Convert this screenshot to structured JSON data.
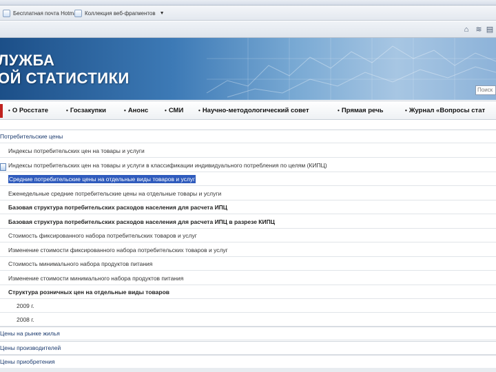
{
  "browser": {
    "favorites": [
      {
        "label": "Бесплатная почта Hotmail",
        "icon": "page-icon"
      },
      {
        "label": "Коллекция веб-фрагментов",
        "icon": "page-icon",
        "has_dropdown": true
      }
    ],
    "command_icons": [
      "home-icon",
      "feed-icon",
      "print-icon"
    ]
  },
  "banner": {
    "title_line1": "ЛУЖБА",
    "title_line2": "ОЙ СТАТИСТИКИ",
    "search_placeholder": "Поиск",
    "colors": {
      "dark": "#1c4f88",
      "light": "#a7c6e3"
    }
  },
  "nav": {
    "accent": "#c0221f",
    "items": [
      "О Росстате",
      "Госзакупки",
      "Анонс",
      "СМИ",
      "Научно-методологический совет",
      "Прямая речь",
      "Журнал «Вопросы стат"
    ]
  },
  "content": {
    "section_main": "Потребительские цены",
    "items": [
      "Индексы потребительских цен на товары и услуги",
      "Индексы потребительских цен на товары и услуги в классификации индивидуального потребления по целям (КИПЦ)",
      "Средние потребительские цены на отдельные виды товаров и услуг",
      "Еженедельные средние потребительские цены на отдельные товары и услуги",
      "Базовая структура потребительских расходов населения для расчета ИПЦ",
      "Базовая структура потребительских расходов населения для расчета ИПЦ в разрезе КИПЦ",
      "Стоимость фиксированного набора потребительских товаров и услуг",
      "Изменение стоимости фиксированного набора потребительских товаров и услуг",
      "Стоимость минимального набора продуктов питания",
      "Изменение стоимости минимального набора продуктов питания",
      "Структура розничных цен на отдельные виды товаров"
    ],
    "selected_index": 2,
    "subitems": [
      "2009 г.",
      "2008 г."
    ],
    "sections_after": [
      "Цены на рынке жилья",
      "Цены производителей",
      "Цены приобретения"
    ],
    "selection_color": "#2f5bbd"
  }
}
